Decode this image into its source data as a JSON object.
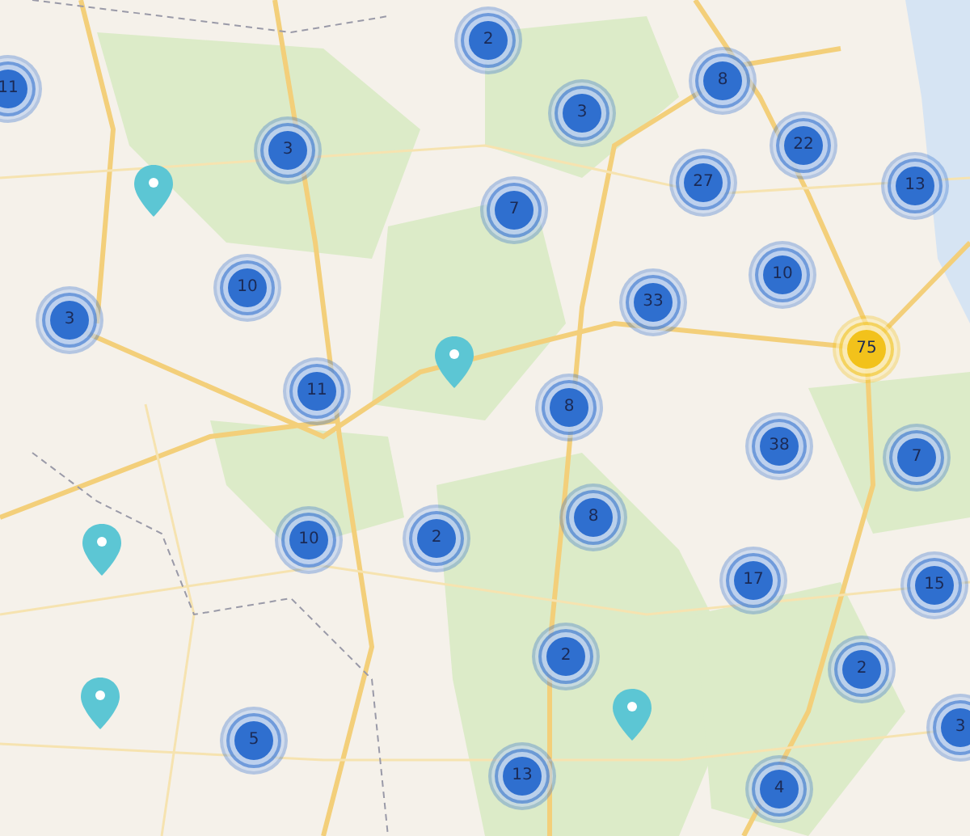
{
  "map": {
    "markers": [
      {
        "kind": "cluster",
        "count": "11",
        "color": "#2f6fcf"
      },
      {
        "kind": "cluster",
        "count": "2",
        "color": "#2f6fcf"
      },
      {
        "kind": "cluster",
        "count": "3",
        "color": "#2f6fcf"
      },
      {
        "kind": "cluster",
        "count": "8",
        "color": "#2f6fcf"
      },
      {
        "kind": "cluster",
        "count": "3",
        "color": "#2f6fcf"
      },
      {
        "kind": "cluster",
        "count": "22",
        "color": "#2f6fcf"
      },
      {
        "kind": "cluster",
        "count": "27",
        "color": "#2f6fcf"
      },
      {
        "kind": "cluster",
        "count": "13",
        "color": "#2f6fcf"
      },
      {
        "kind": "cluster",
        "count": "7",
        "color": "#2f6fcf"
      },
      {
        "kind": "pin"
      },
      {
        "kind": "cluster",
        "count": "10",
        "color": "#2f6fcf"
      },
      {
        "kind": "cluster",
        "count": "10",
        "color": "#2f6fcf"
      },
      {
        "kind": "cluster",
        "count": "33",
        "color": "#2f6fcf"
      },
      {
        "kind": "cluster",
        "count": "3",
        "color": "#2f6fcf"
      },
      {
        "kind": "cluster",
        "count": "75",
        "color": "#f2c21b"
      },
      {
        "kind": "pin"
      },
      {
        "kind": "cluster",
        "count": "11",
        "color": "#2f6fcf"
      },
      {
        "kind": "cluster",
        "count": "8",
        "color": "#2f6fcf"
      },
      {
        "kind": "cluster",
        "count": "38",
        "color": "#2f6fcf"
      },
      {
        "kind": "cluster",
        "count": "7",
        "color": "#2f6fcf"
      },
      {
        "kind": "cluster",
        "count": "8",
        "color": "#2f6fcf"
      },
      {
        "kind": "cluster",
        "count": "10",
        "color": "#2f6fcf"
      },
      {
        "kind": "cluster",
        "count": "2",
        "color": "#2f6fcf"
      },
      {
        "kind": "pin"
      },
      {
        "kind": "cluster",
        "count": "17",
        "color": "#2f6fcf"
      },
      {
        "kind": "cluster",
        "count": "15",
        "color": "#2f6fcf"
      },
      {
        "kind": "cluster",
        "count": "2",
        "color": "#2f6fcf"
      },
      {
        "kind": "cluster",
        "count": "2",
        "color": "#2f6fcf"
      },
      {
        "kind": "pin"
      },
      {
        "kind": "pin"
      },
      {
        "kind": "cluster",
        "count": "3",
        "color": "#2f6fcf"
      },
      {
        "kind": "cluster",
        "count": "5",
        "color": "#2f6fcf"
      },
      {
        "kind": "cluster",
        "count": "13",
        "color": "#2f6fcf"
      },
      {
        "kind": "cluster",
        "count": "4",
        "color": "#2f6fcf"
      }
    ]
  }
}
